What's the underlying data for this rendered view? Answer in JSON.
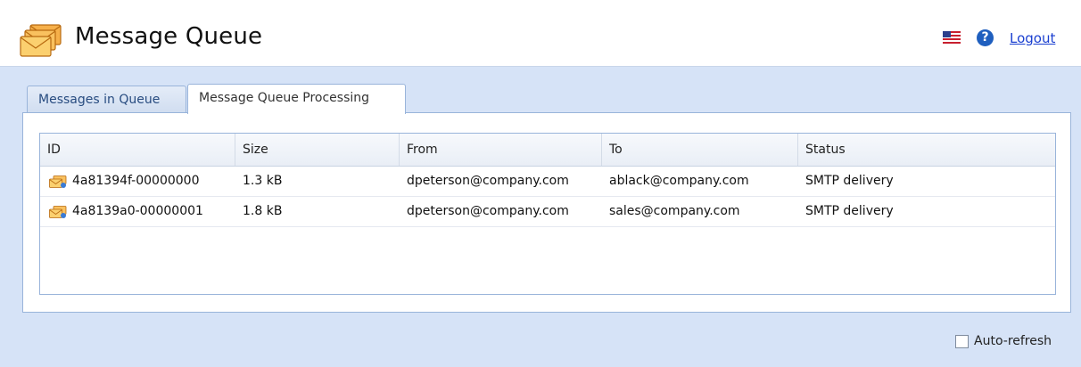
{
  "header": {
    "title": "Message Queue",
    "app_icon": "envelopes-icon",
    "logout_label": "Logout",
    "language_icon": "us-flag-icon",
    "help_icon": "help-icon"
  },
  "tabs": [
    {
      "label": "Messages in Queue",
      "active": false
    },
    {
      "label": "Message Queue Processing",
      "active": true
    }
  ],
  "grid": {
    "columns": [
      "ID",
      "Size",
      "From",
      "To",
      "Status"
    ],
    "rows": [
      {
        "id": "4a81394f-00000000",
        "size": "1.3 kB",
        "from": "dpeterson@company.com",
        "to": "ablack@company.com",
        "status": "SMTP delivery"
      },
      {
        "id": "4a8139a0-00000001",
        "size": "1.8 kB",
        "from": "dpeterson@company.com",
        "to": "sales@company.com",
        "status": "SMTP delivery"
      }
    ]
  },
  "footer": {
    "autorefresh_label": "Auto-refresh",
    "autorefresh_checked": false
  },
  "colors": {
    "background": "#d6e3f7",
    "border": "#99b4da",
    "link": "#1a3fd0"
  }
}
